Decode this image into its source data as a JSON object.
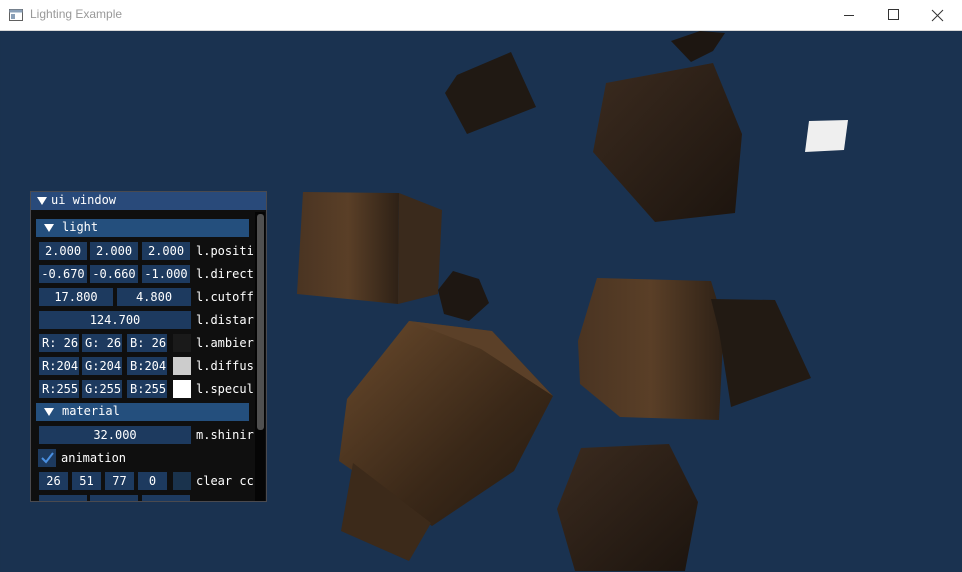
{
  "window": {
    "title": "Lighting Example",
    "icon": "app-window-icon"
  },
  "ui_window": {
    "title": "ui window",
    "light_header": "light",
    "position": {
      "values": [
        "2.000",
        "2.000",
        "2.000"
      ],
      "label": "l.positi"
    },
    "direction": {
      "values": [
        "-0.670",
        "-0.660",
        "-1.000"
      ],
      "label": "l.direct"
    },
    "cutoff": {
      "values": [
        "17.800",
        "4.800"
      ],
      "label": "l.cutoff"
    },
    "distance": {
      "value": "124.700",
      "label": "l.distar"
    },
    "ambient": {
      "values": [
        "R: 26",
        "G: 26",
        "B: 26"
      ],
      "label": "l.ambier",
      "color": "#1a1a1a"
    },
    "diffuse": {
      "values": [
        "R:204",
        "G:204",
        "B:204"
      ],
      "label": "l.diffus",
      "color": "#cccccc"
    },
    "specular": {
      "values": [
        "R:255",
        "G:255",
        "B:255"
      ],
      "label": "l.specul",
      "color": "#ffffff"
    },
    "material_header": "material",
    "shininess": {
      "value": "32.000",
      "label": "m.shinir"
    },
    "animation": {
      "label": "animation",
      "checked": true
    },
    "clear_color": {
      "values": [
        "26",
        "51",
        "77",
        "0"
      ],
      "label": "clear cc",
      "color": "#1a334d"
    }
  },
  "colors": {
    "background": "#1a324f",
    "widget_bg": "#1d3a5f",
    "header_bg": "#244f7d",
    "title_active": "#294a7a",
    "check": "#4a90e2"
  }
}
